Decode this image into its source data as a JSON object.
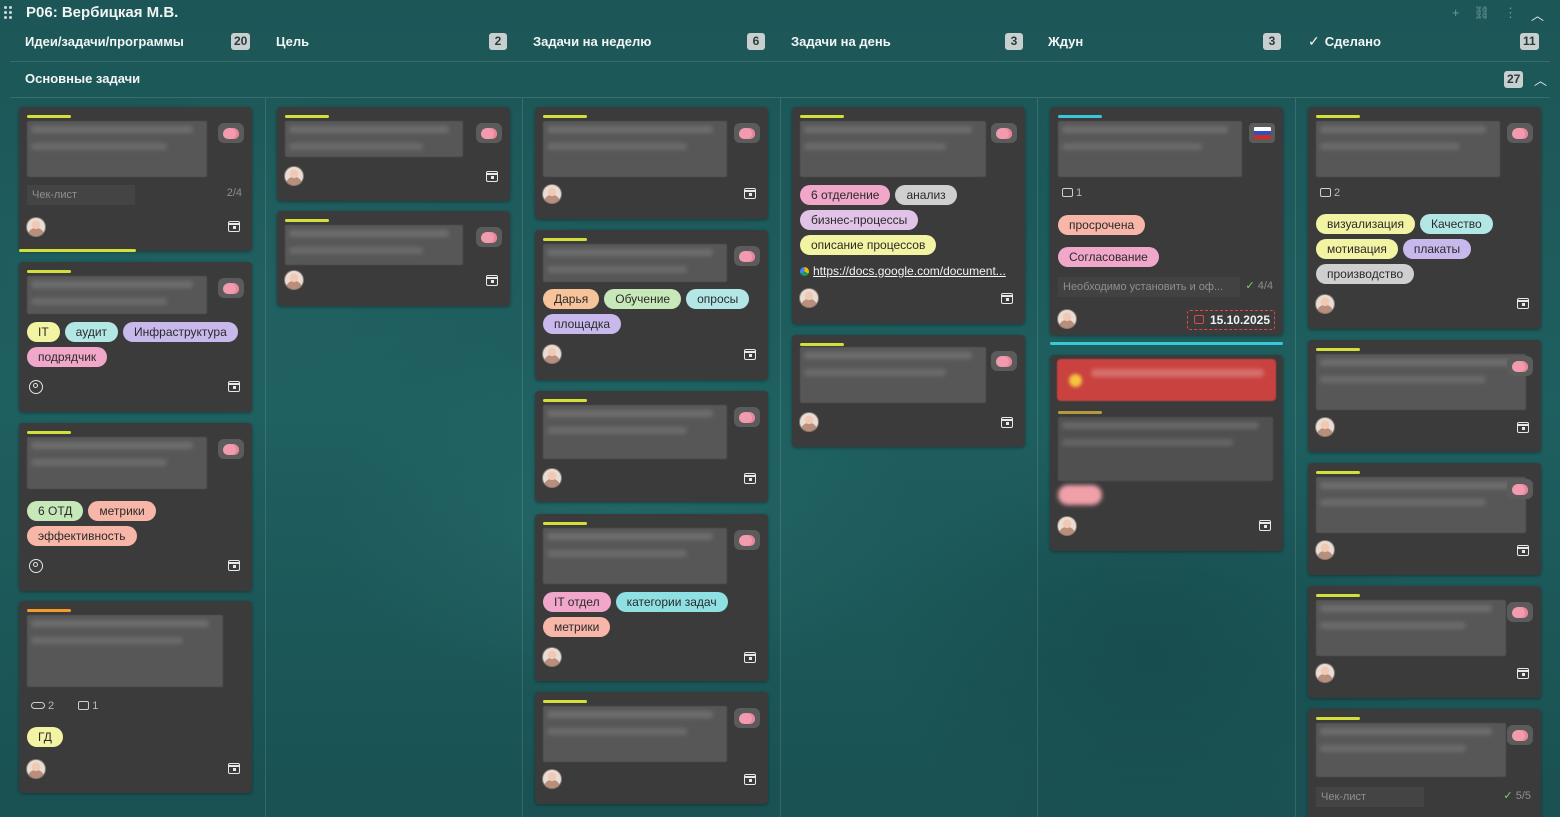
{
  "board": {
    "title": "Р06: Вербицкая М.В."
  },
  "columns": [
    {
      "name": "Идеи/задачи/программы",
      "count": "20"
    },
    {
      "name": "Цель",
      "count": "2"
    },
    {
      "name": "Задачи на неделю",
      "count": "6"
    },
    {
      "name": "Задачи на день",
      "count": "3"
    },
    {
      "name": "Ждун",
      "count": "3"
    },
    {
      "name": "Сделано",
      "count": "11"
    }
  ],
  "swimlane": {
    "name": "Основные задачи",
    "count": "27"
  },
  "cards": {
    "c1": {
      "checklist_label": "Чек-лист",
      "checklist_count": "2/4"
    },
    "c2": {
      "tags": [
        "IT",
        "аудит",
        "Инфраструктура",
        "подрядчик"
      ]
    },
    "c3": {
      "tags": [
        "6 ОТД",
        "метрики",
        "эффективность"
      ]
    },
    "c4": {
      "attachments": "2",
      "comments": "1",
      "tags": [
        "ГД"
      ]
    },
    "w2": {
      "tags": [
        "Дарья",
        "Обучение",
        "опросы",
        "площадка"
      ]
    },
    "w4": {
      "tags": [
        "IT отдел",
        "категории задач",
        "метрики"
      ]
    },
    "d1": {
      "tags": [
        "6 отделение",
        "анализ",
        "бизнес-процессы",
        "описание процессов"
      ],
      "link": "https://docs.google.com/document..."
    },
    "z1": {
      "comments": "1",
      "tags": [
        "просрочена",
        "Согласование"
      ],
      "checklist_text": "Необходимо установить и оф...",
      "checklist_count": "4/4",
      "due_date": "15.10.2025"
    },
    "s1": {
      "comments": "2",
      "tags": [
        "визуализация",
        "Качество",
        "мотивация",
        "плакаты",
        "производство"
      ]
    },
    "s5": {
      "checklist_label": "Чек-лист",
      "checklist_count": "5/5"
    }
  },
  "colors": {
    "accent_strip": "#d5df3c",
    "orange_strip": "#f39a2b",
    "cyan_strip": "#38c8d8",
    "overdue": "#e04848"
  },
  "icons": [
    "drag-handle-icon",
    "plus-icon",
    "link-icon",
    "more-icon",
    "chevron-up-icon",
    "check-icon",
    "brain-icon",
    "calendar-icon",
    "user-icon",
    "comment-icon",
    "attachment-icon",
    "flag-ru-icon"
  ]
}
